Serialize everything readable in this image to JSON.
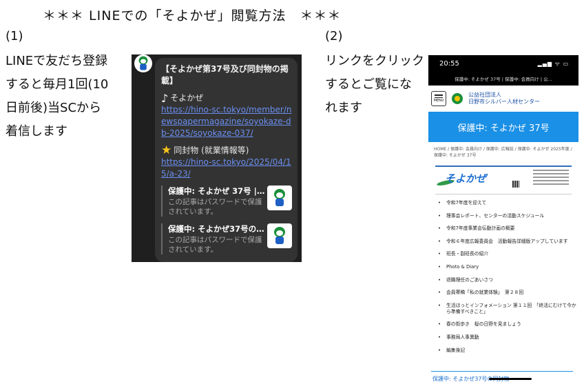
{
  "heading": "＊＊＊ LINEでの「そよかぜ」閲覧方法　＊＊＊",
  "steps": [
    {
      "number": "(1)",
      "lines": [
        "LINEで友だち登録",
        "すると毎月1回(10",
        "日前後)当SCから",
        "着信します"
      ]
    },
    {
      "number": "(2)",
      "lines": [
        "リンクをクリック",
        "するとご覧にな",
        "れます"
      ]
    }
  ],
  "line_message": {
    "title": "【そよかぜ第37号及び同封物の掲載】",
    "item1_icon": "music-note-icon",
    "item1_label": "そよかぜ",
    "item1_link": "https://hino-sc.tokyo/member/newspapermagazine/soyokaze-db-2025/soyokaze-037/",
    "item2_icon": "star-icon",
    "item2_label": "同封物 (就業情報等)",
    "item2_link": "https://hino-sc.tokyo/2025/04/15/a-23/",
    "previews": [
      {
        "title": "保護中: そよかぜ 37号 |…",
        "description": "この記事はパスワードで保護されています。"
      },
      {
        "title": "保護中: そよかぜ37号の…",
        "description": "この記事はパスワードで保護されています。"
      }
    ]
  },
  "phone": {
    "time": "20:55",
    "status_icons": "▂▄▆ ᯤ ▭",
    "url_bar": "保護中: そよかぜ 37号 | 保護中: 会員向け | 公...",
    "menu_label": "MENU",
    "org_line1": "公益社団法人",
    "org_line2": "日野市シルバー人材センター",
    "banner": "保護中: そよかぜ 37号",
    "breadcrumb": "HOME / 保護中: 会員向け / 保護中: 広報誌 / 保護中: そよかぜ 2025年度 / 保護中: そよかぜ 37号",
    "magazine_logo": "そよかぜ",
    "list_items": [
      "令和7年度を迎えて",
      "理事会レポート、センターの活動スケジュール",
      "令和7年度事業会伝動計画の概要",
      "令和６年度広報委員会　活動報告詳細版アップしています",
      "班長・副班長の紹介",
      "Photo & Diary",
      "退職理任のごあいさつ",
      "会員寄稿「私の就業体験」　第２８回",
      "生活ほっとインフォメーション 第１１回　「終活にむけて今から準備すべきこと」",
      "春の街歩き　桜の日野を見ましょう",
      "事務局人事異動",
      "編集後記"
    ],
    "footer_text": "保護中: そよかぜ37号の同封物"
  }
}
